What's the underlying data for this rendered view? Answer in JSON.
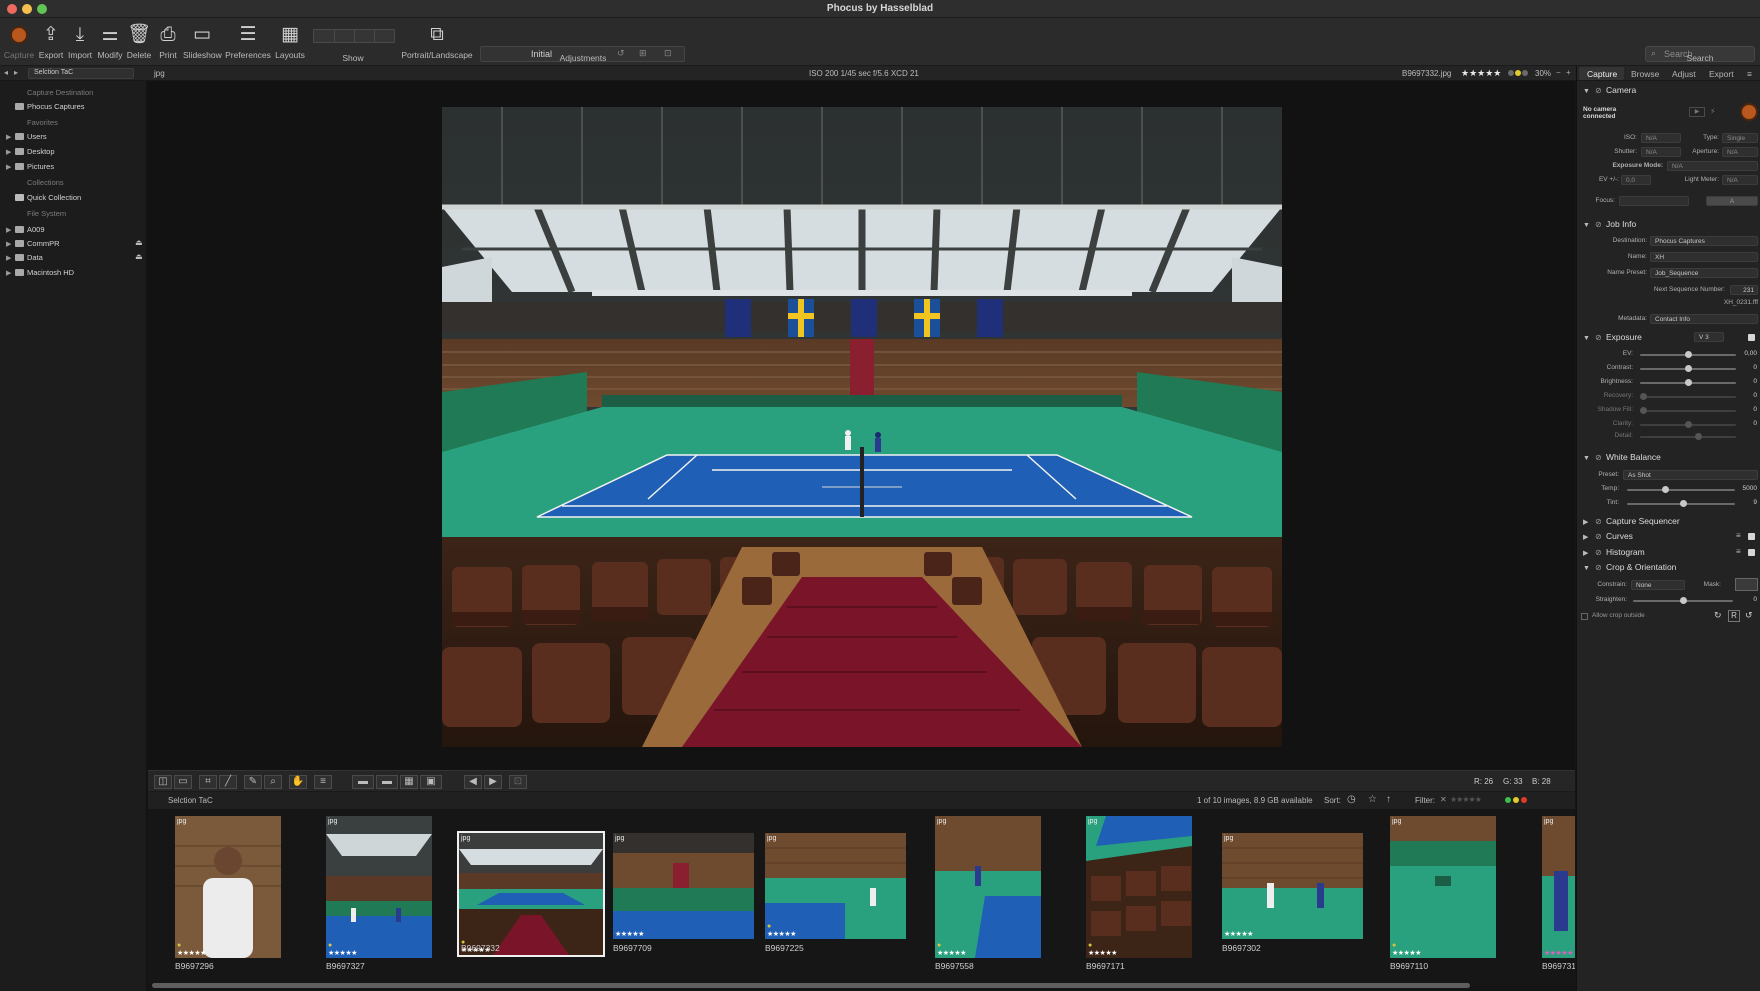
{
  "window": {
    "title": "Phocus by Hasselblad"
  },
  "toolbar": {
    "capture": "Capture",
    "export": "Export",
    "import": "Import",
    "modify": "Modify",
    "delete": "Delete",
    "print": "Print",
    "slideshow": "Slideshow",
    "preferences": "Preferences",
    "layouts": "Layouts",
    "show": "Show",
    "portrait_landscape": "Portrait/Landscape",
    "adjustments": "Adjustments",
    "adjustment_preset": "Initial",
    "search_placeholder": "Search",
    "search_label": "Search"
  },
  "infostrip": {
    "folder": "Selction TaC",
    "format": "jpg",
    "exif": "ISO 200  1/45 sec  f/5.6  XCD 21",
    "filename": "B9697332.jpg",
    "rating": "★★★★★",
    "zoom": "30%"
  },
  "left_panel": {
    "capture_destination": "Capture Destination",
    "phocus_captures": "Phocus Captures",
    "favorites": "Favorites",
    "users": "Users",
    "desktop": "Desktop",
    "pictures": "Pictures",
    "collections": "Collections",
    "quick_collection": "Quick Collection",
    "file_system": "File System",
    "a009": "A009",
    "commpr": "CommPR",
    "data": "Data",
    "macintosh_hd": "Macintosh HD"
  },
  "filmbar": {
    "folder": "Selction TaC",
    "count": "1 of 10 images, 8.9 GB available",
    "sort": "Sort:",
    "filter": "Filter:"
  },
  "rgb_readout": {
    "r": "R:  26",
    "g": "G:  33",
    "b": "B:  28"
  },
  "thumbnails": [
    {
      "name": "B9697296",
      "format": "jpg",
      "stars": "★★★★★"
    },
    {
      "name": "B9697327",
      "format": "jpg",
      "stars": "★★★★★"
    },
    {
      "name": "B9697332",
      "format": "jpg",
      "stars": "★★★★★"
    },
    {
      "name": "B9697709",
      "format": "jpg",
      "stars": "★★★★★"
    },
    {
      "name": "B9697225",
      "format": "jpg",
      "stars": "★★★★★"
    },
    {
      "name": "B9697558",
      "format": "jpg",
      "stars": "★★★★★"
    },
    {
      "name": "B9697171",
      "format": "jpg",
      "stars": "★★★★★"
    },
    {
      "name": "B9697302",
      "format": "jpg",
      "stars": "★★★★★"
    },
    {
      "name": "B9697110",
      "format": "jpg",
      "stars": "★★★★★"
    },
    {
      "name": "B969731",
      "format": "jpg",
      "stars": "★★★★★"
    }
  ],
  "right_panel": {
    "tabs": [
      "Capture",
      "Browse",
      "Adjust",
      "Export"
    ],
    "camera": {
      "title": "Camera",
      "status": "No camera\nconnected",
      "iso_label": "ISO:",
      "iso": "N/A",
      "type_label": "Type:",
      "type": "Single",
      "shutter_label": "Shutter:",
      "shutter": "N/A",
      "aperture_label": "Aperture:",
      "aperture": "N/A",
      "exposure_mode_label": "Exposure Mode:",
      "exposure_mode": "N/A",
      "ev_label": "EV +/-:",
      "ev": "0,0",
      "light_meter_label": "Light Meter:",
      "light_meter": "N/A",
      "focus_label": "Focus:",
      "focus_mode": "A"
    },
    "job_info": {
      "title": "Job Info",
      "destination_label": "Destination:",
      "destination": "Phocus Captures",
      "name_label": "Name:",
      "name": "XH",
      "name_preset_label": "Name Preset:",
      "name_preset": "Job_Sequence",
      "next_seq_label": "Next Sequence Number:",
      "next_seq": "231",
      "preview_name": "XH_0231.fff",
      "metadata_label": "Metadata:",
      "metadata": "Contact Info"
    },
    "exposure": {
      "title": "Exposure",
      "version": "V 3",
      "ev_label": "EV:",
      "ev": "0,00",
      "ev_pos": 0.5,
      "contrast_label": "Contrast:",
      "contrast": "0",
      "contrast_pos": 0.5,
      "brightness_label": "Brightness:",
      "brightness": "0",
      "brightness_pos": 0.5,
      "recovery_label": "Recovery:",
      "recovery": "0",
      "recovery_pos": 0.0,
      "shadow_fill_label": "Shadow Fill:",
      "shadow_fill": "0",
      "shadow_fill_pos": 0.0,
      "clarity_label": "Clarity:",
      "clarity": "0",
      "clarity_pos": 0.5,
      "detail_label": "Detail:",
      "detail_pos": 0.62
    },
    "white_balance": {
      "title": "White Balance",
      "preset_label": "Preset:",
      "preset": "As Shot",
      "temp_label": "Temp:",
      "temp": "5000",
      "temp_pos": 0.35,
      "tint_label": "Tint:",
      "tint": "9",
      "tint_pos": 0.52
    },
    "capture_sequencer": {
      "title": "Capture Sequencer"
    },
    "curves": {
      "title": "Curves"
    },
    "histogram": {
      "title": "Histogram"
    },
    "crop": {
      "title": "Crop & Orientation",
      "constrain_label": "Constrain:",
      "constrain": "None",
      "mask_label": "Mask:",
      "straighten_label": "Straighten:",
      "straighten": "0",
      "straighten_pos": 0.5,
      "allow_crop_outside": "Allow crop outside"
    }
  }
}
